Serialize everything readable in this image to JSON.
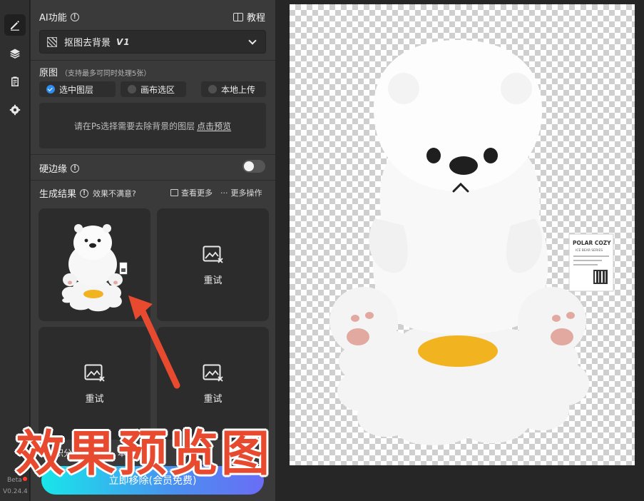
{
  "rail": {
    "items": [
      {
        "name": "brush",
        "active": true
      },
      {
        "name": "layers",
        "active": false
      },
      {
        "name": "clipboard",
        "active": false
      },
      {
        "name": "settings",
        "active": false
      }
    ],
    "beta_label": "Beta",
    "version": "V0.24.4"
  },
  "ai_section": {
    "title": "AI功能",
    "tutorial_label": "教程",
    "selected_function": "抠图去背景",
    "function_badge": "V1"
  },
  "original": {
    "title": "原图",
    "subtitle": "（支持最多可同时处理5张）",
    "options": [
      {
        "label": "选中图层",
        "selected": true
      },
      {
        "label": "画布选区",
        "selected": false
      },
      {
        "label": "本地上传",
        "selected": false
      }
    ],
    "hint": "请在Ps选择需要去除背景的图层",
    "preview_link": "点击预览"
  },
  "hard_edge": {
    "label": "硬边缘",
    "enabled": false
  },
  "results": {
    "title": "生成结果",
    "dissatisfied_label": "效果不满意?",
    "view_more": "查看更多",
    "more_actions": "更多操作",
    "cards": [
      {
        "state": "image"
      },
      {
        "state": "retry",
        "label": "重试"
      },
      {
        "state": "retry",
        "label": "重试"
      },
      {
        "state": "retry",
        "label": "重试"
      }
    ]
  },
  "cost_row": {
    "prefix": "积分",
    "middle": "本次",
    "suffix": "积"
  },
  "cta": {
    "label": "立即移除(会员免费)"
  },
  "annotation": {
    "title": "效果预览图"
  },
  "product_tag": {
    "brand": "POLAR COZY",
    "line": "ICE BEAR SERIES"
  },
  "colors": {
    "accent_blue": "#2d8cf0",
    "annotation_red": "#e74a2f",
    "egg_yolk": "#f2b321"
  }
}
